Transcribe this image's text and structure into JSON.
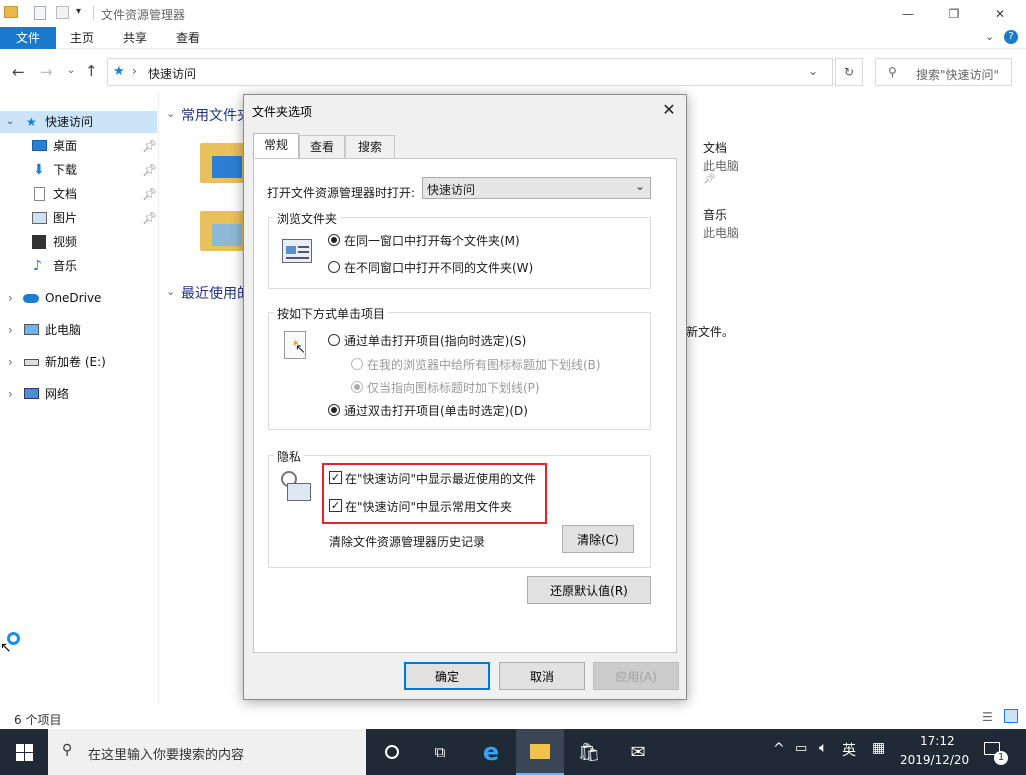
{
  "window": {
    "title": "文件资源管理器",
    "ribbon_tabs": [
      "文件",
      "主页",
      "共享",
      "查看"
    ]
  },
  "address": {
    "path": "快速访问",
    "search_placeholder": "搜索\"快速访问\""
  },
  "nav": {
    "quick_access": "快速访问",
    "items": [
      {
        "label": "桌面",
        "icon": "desktop-icon",
        "pinned": true
      },
      {
        "label": "下载",
        "icon": "download-icon",
        "pinned": true
      },
      {
        "label": "文档",
        "icon": "document-icon",
        "pinned": true
      },
      {
        "label": "图片",
        "icon": "picture-icon",
        "pinned": true
      },
      {
        "label": "视频",
        "icon": "video-icon",
        "pinned": false
      },
      {
        "label": "音乐",
        "icon": "music-icon",
        "pinned": false
      }
    ],
    "onedrive": "OneDrive",
    "this_pc": "此电脑",
    "drive": "新加卷 (E:)",
    "network": "网络"
  },
  "content": {
    "frequent_header": "常用文件夹",
    "recent_header": "最近使用的文件",
    "right_items": [
      {
        "name": "文档",
        "sub": "此电脑"
      },
      {
        "name": "音乐",
        "sub": "此电脑"
      }
    ],
    "recent_note": "新文件。"
  },
  "status": {
    "count": "6 个项目"
  },
  "taskbar": {
    "search_placeholder": "在这里输入你要搜索的内容",
    "ime": "英",
    "time": "17:12",
    "date": "2019/12/20",
    "notifications": "1"
  },
  "dialog": {
    "title": "文件夹选项",
    "tabs": [
      "常规",
      "查看",
      "搜索"
    ],
    "open_label": "打开文件资源管理器时打开:",
    "open_value": "快速访问",
    "browse_group": "浏览文件夹",
    "browse_same": "在同一窗口中打开每个文件夹(M)",
    "browse_diff": "在不同窗口中打开不同的文件夹(W)",
    "click_group": "按如下方式单击项目",
    "single_click": "通过单击打开项目(指向时选定)(S)",
    "underline_browser": "在我的浏览器中给所有图标标题加下划线(B)",
    "underline_point": "仅当指向图标标题时加下划线(P)",
    "double_click": "通过双击打开项目(单击时选定)(D)",
    "privacy_group": "隐私",
    "show_recent": "在\"快速访问\"中显示最近使用的文件",
    "show_frequent": "在\"快速访问\"中显示常用文件夹",
    "clear_history": "清除文件资源管理器历史记录",
    "clear_btn": "清除(C)",
    "restore_btn": "还原默认值(R)",
    "ok_btn": "确定",
    "cancel_btn": "取消",
    "apply_btn": "应用(A)",
    "highlight_color": "#e0252b"
  }
}
